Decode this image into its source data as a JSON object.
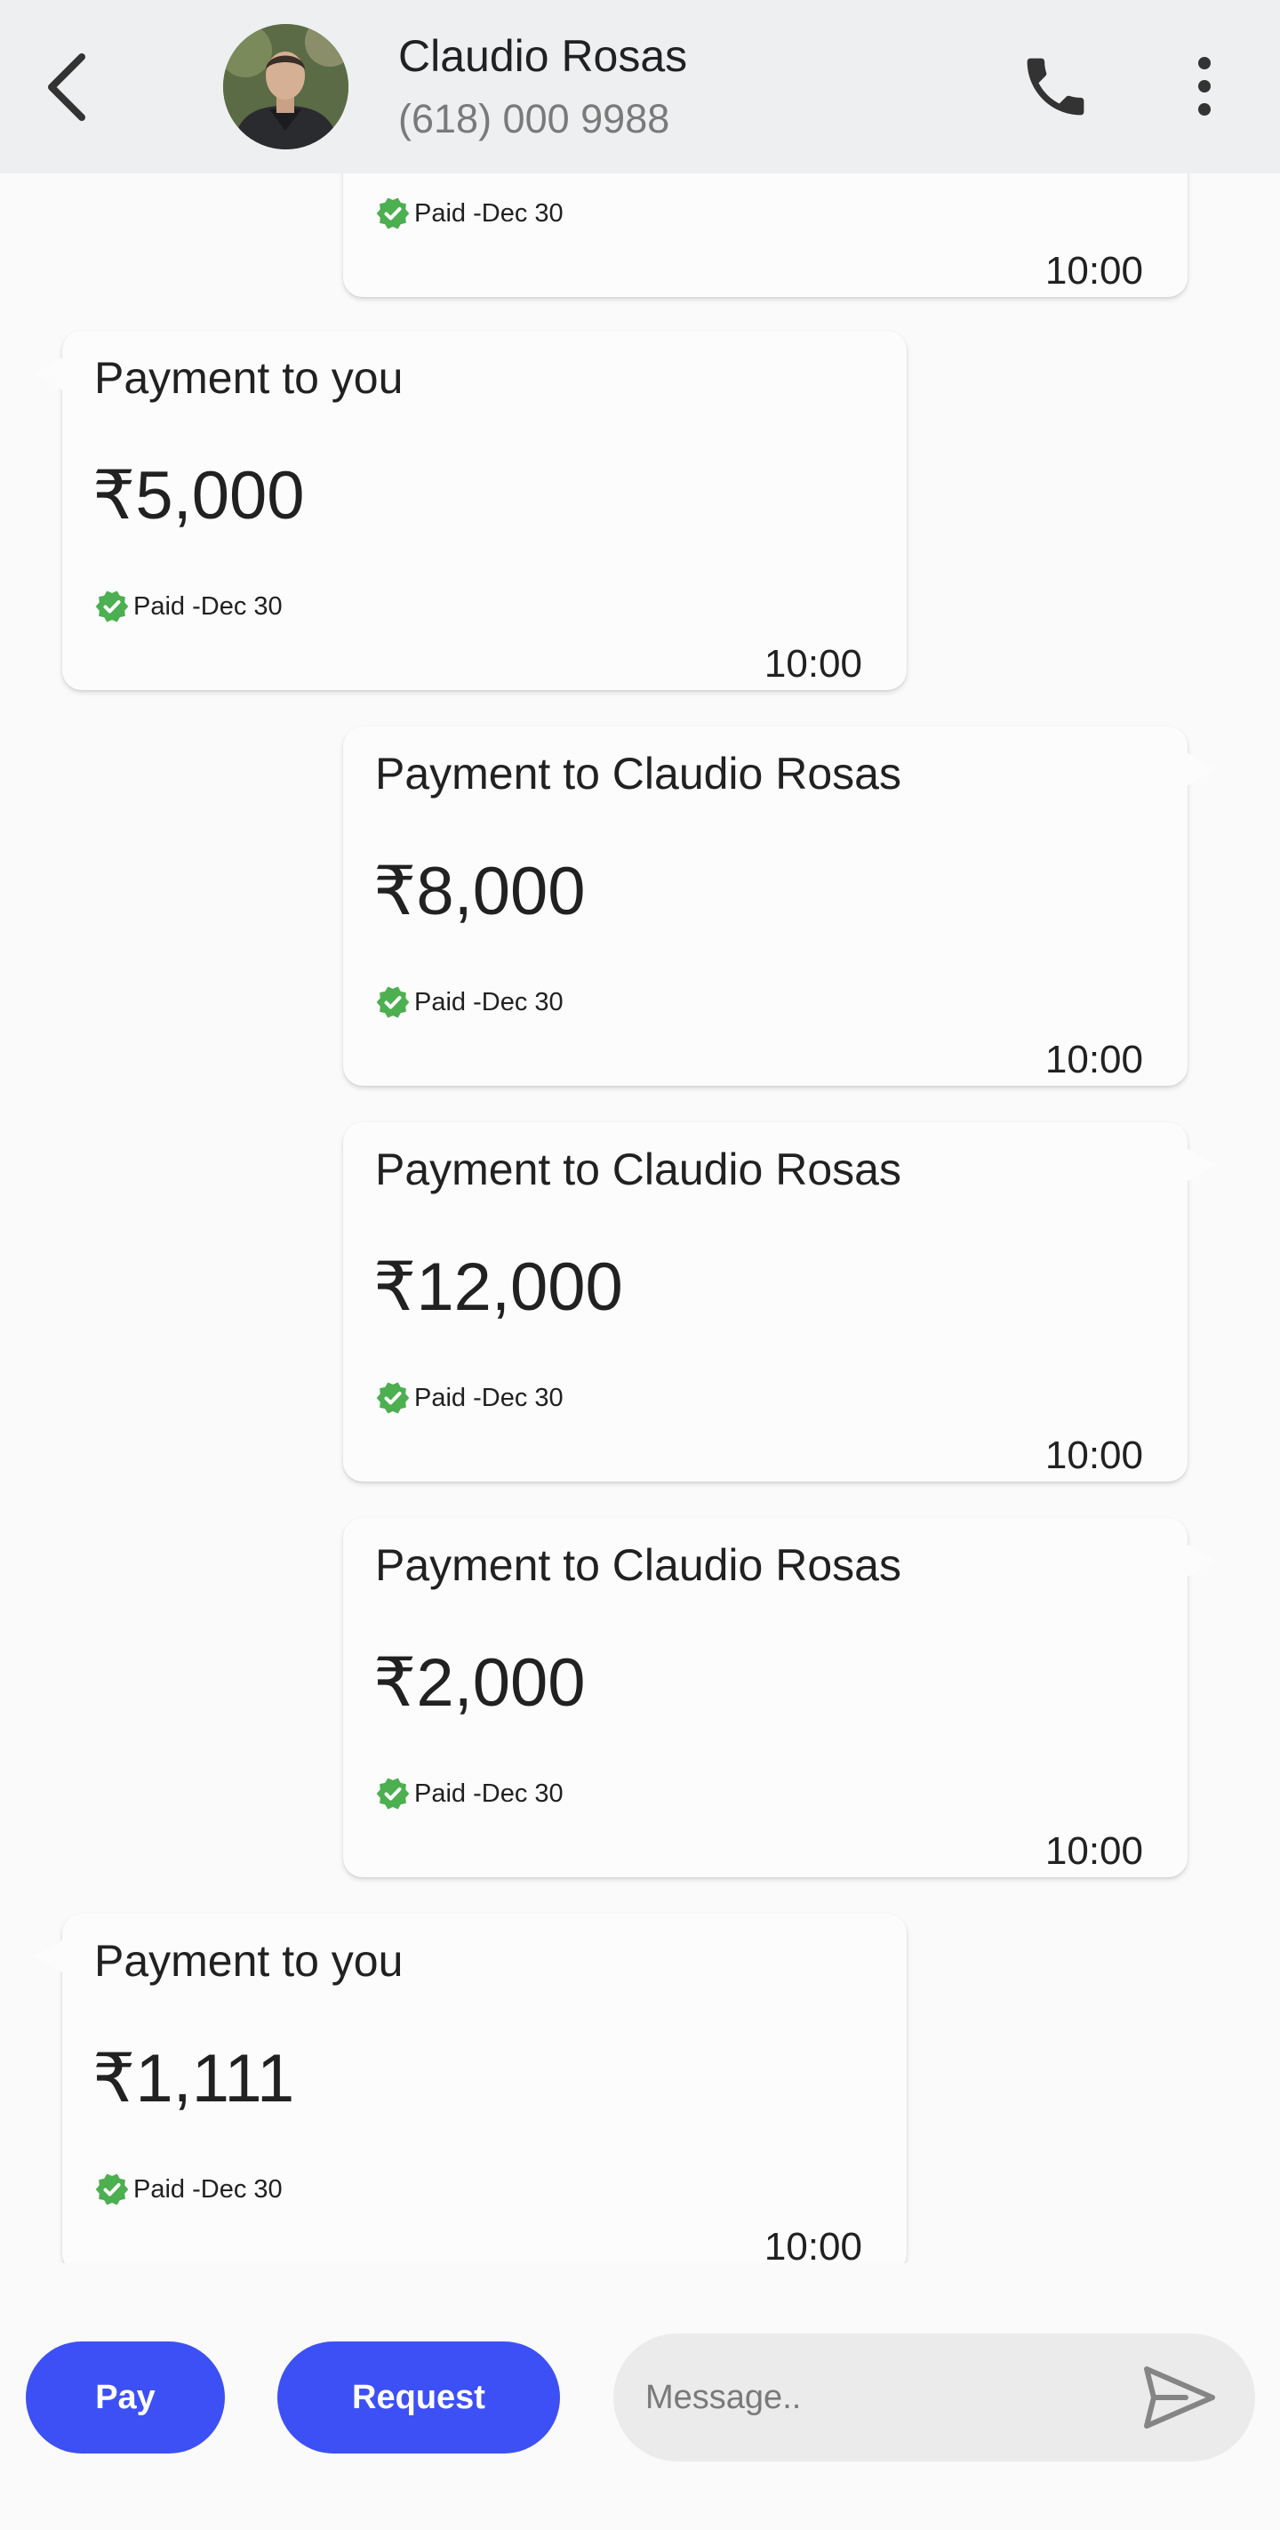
{
  "header": {
    "contact_name": "Claudio Rosas",
    "contact_phone": "(618) 000 9988"
  },
  "messages": [
    {
      "direction": "sent",
      "title": "",
      "amount": "",
      "status": "Paid -Dec 30",
      "time": "10:00"
    },
    {
      "direction": "received",
      "title": "Payment to you",
      "amount": "₹5,000",
      "status": "Paid -Dec 30",
      "time": "10:00"
    },
    {
      "direction": "sent",
      "title": "Payment to Claudio Rosas",
      "amount": "₹8,000",
      "status": "Paid -Dec 30",
      "time": "10:00"
    },
    {
      "direction": "sent",
      "title": "Payment to Claudio Rosas",
      "amount": "₹12,000",
      "status": "Paid -Dec 30",
      "time": "10:00"
    },
    {
      "direction": "sent",
      "title": "Payment to Claudio Rosas",
      "amount": "₹2,000",
      "status": "Paid -Dec 30",
      "time": "10:00"
    },
    {
      "direction": "received",
      "title": "Payment to you",
      "amount": "₹1,111",
      "status": "Paid -Dec 30",
      "time": "10:00"
    }
  ],
  "composer": {
    "pay_label": "Pay",
    "request_label": "Request",
    "message_placeholder": "Message.."
  },
  "colors": {
    "accent": "#3d50f5",
    "header_bg": "#eeeff1",
    "paid_check": "#4caf50"
  }
}
